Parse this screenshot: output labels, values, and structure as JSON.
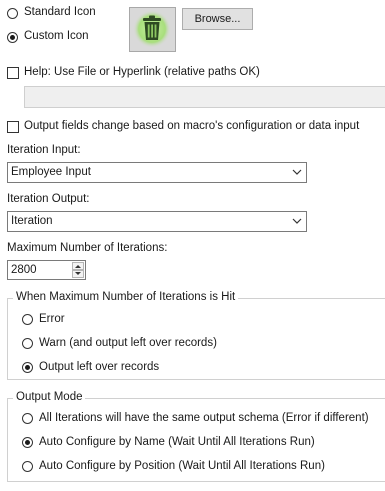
{
  "icon": {
    "standard_label": "Standard Icon",
    "custom_label": "Custom Icon",
    "selected": "custom",
    "preview_icon": "trash-can-icon",
    "preview_color": "#7ab648",
    "browse_label": "Browse..."
  },
  "help": {
    "label": "Help: Use File or Hyperlink (relative paths OK)",
    "checked": false,
    "value": ""
  },
  "output_fields": {
    "label": "Output fields change based on macro's configuration or data input",
    "checked": false
  },
  "iteration_input": {
    "label": "Iteration Input:",
    "value": "Employee Input"
  },
  "iteration_output": {
    "label": "Iteration Output:",
    "value": "Iteration"
  },
  "max_iterations": {
    "label": "Maximum Number of Iterations:",
    "value": "2800"
  },
  "max_hit": {
    "title": "When Maximum Number of Iterations is Hit",
    "options": [
      "Error",
      "Warn (and output left over records)",
      "Output left over records"
    ],
    "selected_index": 2
  },
  "output_mode": {
    "title": "Output Mode",
    "options": [
      "All Iterations will have the same output schema (Error if different)",
      "Auto Configure by Name (Wait Until All Iterations Run)",
      "Auto Configure by Position (Wait Until All Iterations Run)"
    ],
    "selected_index": 1
  }
}
